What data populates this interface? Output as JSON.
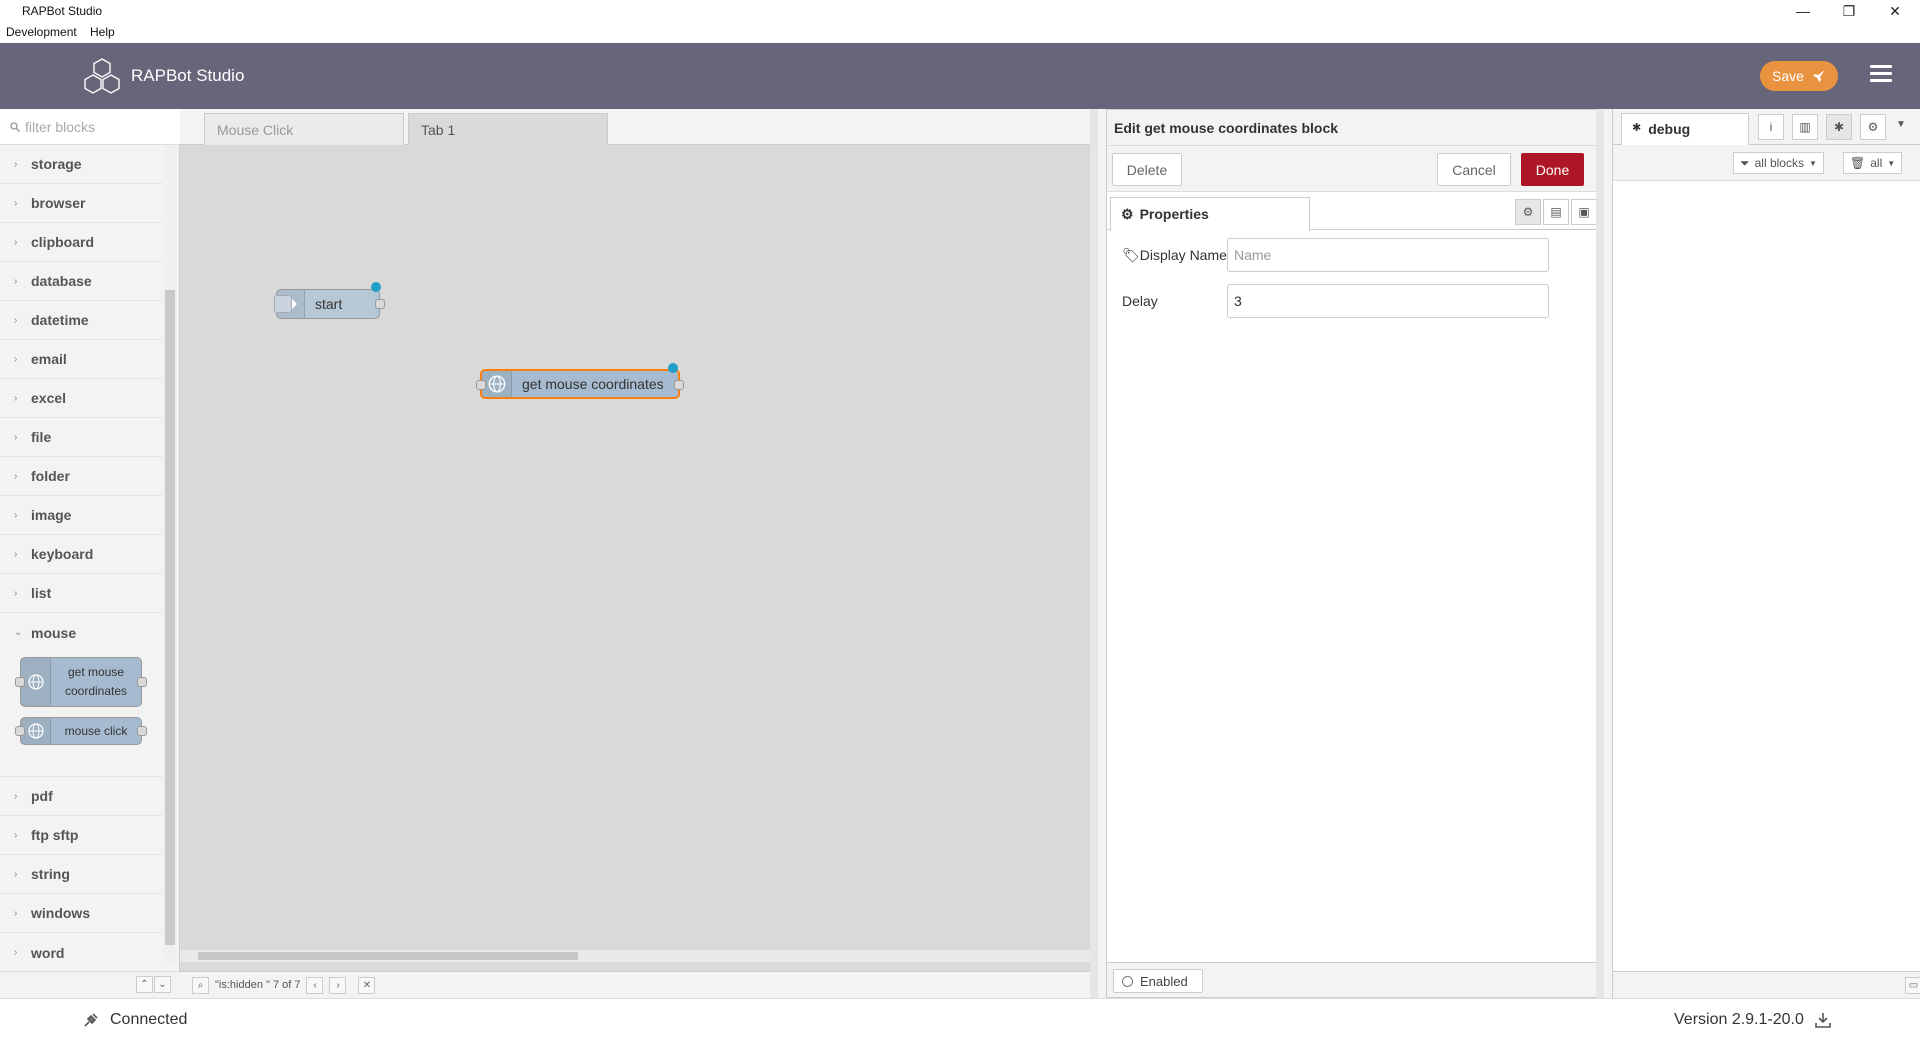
{
  "window": {
    "title": "RAPBot Studio",
    "menu": [
      "Development",
      "Help"
    ],
    "controls": {
      "minimize": "—",
      "restore": "❐",
      "close": "✕"
    }
  },
  "header": {
    "brand": "RAPBot Studio",
    "save_label": "Save"
  },
  "palette": {
    "filter_placeholder": "filter blocks",
    "categories_top": [
      "storage",
      "browser",
      "clipboard",
      "database",
      "datetime",
      "email",
      "excel",
      "file",
      "folder",
      "image",
      "keyboard",
      "list",
      "mouse"
    ],
    "mouse_nodes": [
      "get mouse coordinates",
      "mouse click"
    ],
    "categories_bottom": [
      "pdf",
      "ftp sftp",
      "string",
      "windows",
      "word"
    ]
  },
  "workspace": {
    "tabs": [
      "Mouse Click",
      "Tab 1"
    ],
    "nodes": {
      "start": "start",
      "get_mouse": "get mouse coordinates"
    },
    "search_status": "\"is:hidden \" 7 of 7"
  },
  "tray": {
    "title": "Edit get mouse coordinates block",
    "delete_label": "Delete",
    "cancel_label": "Cancel",
    "done_label": "Done",
    "properties_tab": "Properties",
    "display_name_label": "Display Name",
    "display_name_placeholder": "Name",
    "display_name_value": "",
    "delay_label": "Delay",
    "delay_value": "3",
    "enabled_label": "Enabled"
  },
  "sidebar": {
    "tab_label": "debug",
    "filter_label": "all blocks",
    "clear_label": "all"
  },
  "status": {
    "connection": "Connected",
    "version": "Version 2.9.1-20.0"
  },
  "colors": {
    "header": "#676579",
    "save": "#e99240",
    "done": "#ad1625",
    "node": "#a6bbcf",
    "port_active": "#1f9ec8"
  }
}
